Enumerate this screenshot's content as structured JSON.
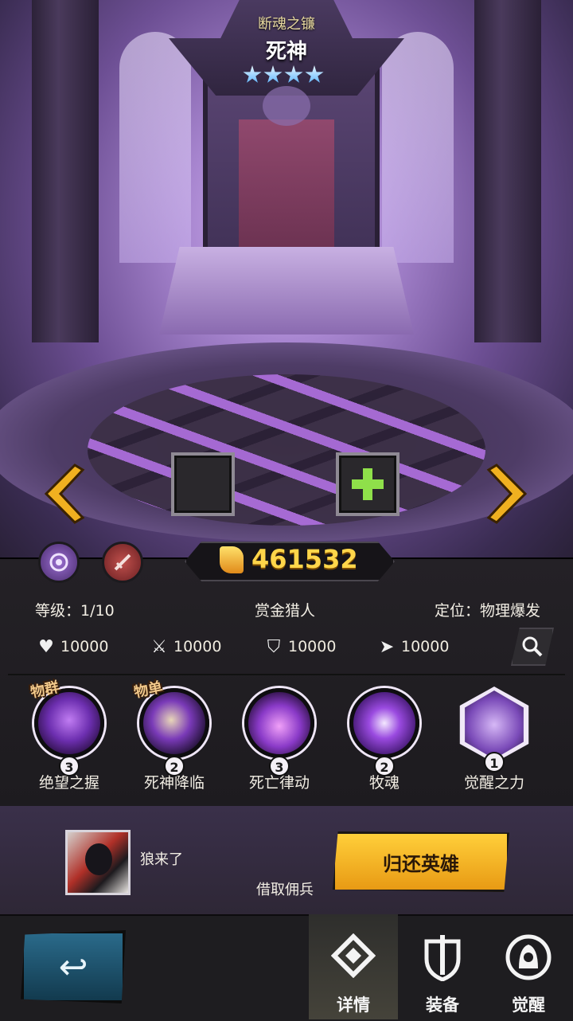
{
  "hero": {
    "weapon_name": "断魂之镰",
    "name": "死神",
    "stars": 4
  },
  "power": "461532",
  "info": {
    "level": "等级：1/10",
    "job": "赏金猎人",
    "position": "定位：物理爆发"
  },
  "stats": [
    {
      "icon": "health-icon",
      "value": "10000"
    },
    {
      "icon": "attack-icon",
      "value": "10000"
    },
    {
      "icon": "defense-icon",
      "value": "10000"
    },
    {
      "icon": "speed-icon",
      "value": "10000"
    }
  ],
  "skills": [
    {
      "name": "绝望之握",
      "level": "3",
      "tag": "物群"
    },
    {
      "name": "死神降临",
      "level": "2",
      "tag": "物单"
    },
    {
      "name": "死亡律动",
      "level": "3",
      "tag": ""
    },
    {
      "name": "牧魂",
      "level": "2",
      "tag": ""
    },
    {
      "name": "觉醒之力",
      "level": "1",
      "tag": ""
    }
  ],
  "mercenary": {
    "name": "狼来了",
    "borrow_label": "借取佣兵",
    "return_button": "归还英雄"
  },
  "nav": {
    "tabs": [
      {
        "label": "详情",
        "icon": "details-icon",
        "active": true
      },
      {
        "label": "装备",
        "icon": "equipment-icon",
        "active": false
      },
      {
        "label": "觉醒",
        "icon": "awaken-icon",
        "active": false
      }
    ]
  },
  "colors": {
    "power_gold": "#ffd64a",
    "star_blue": "#5ab4ff",
    "return_button": "#f5b52a",
    "slot_plus": "#8fe04a"
  }
}
